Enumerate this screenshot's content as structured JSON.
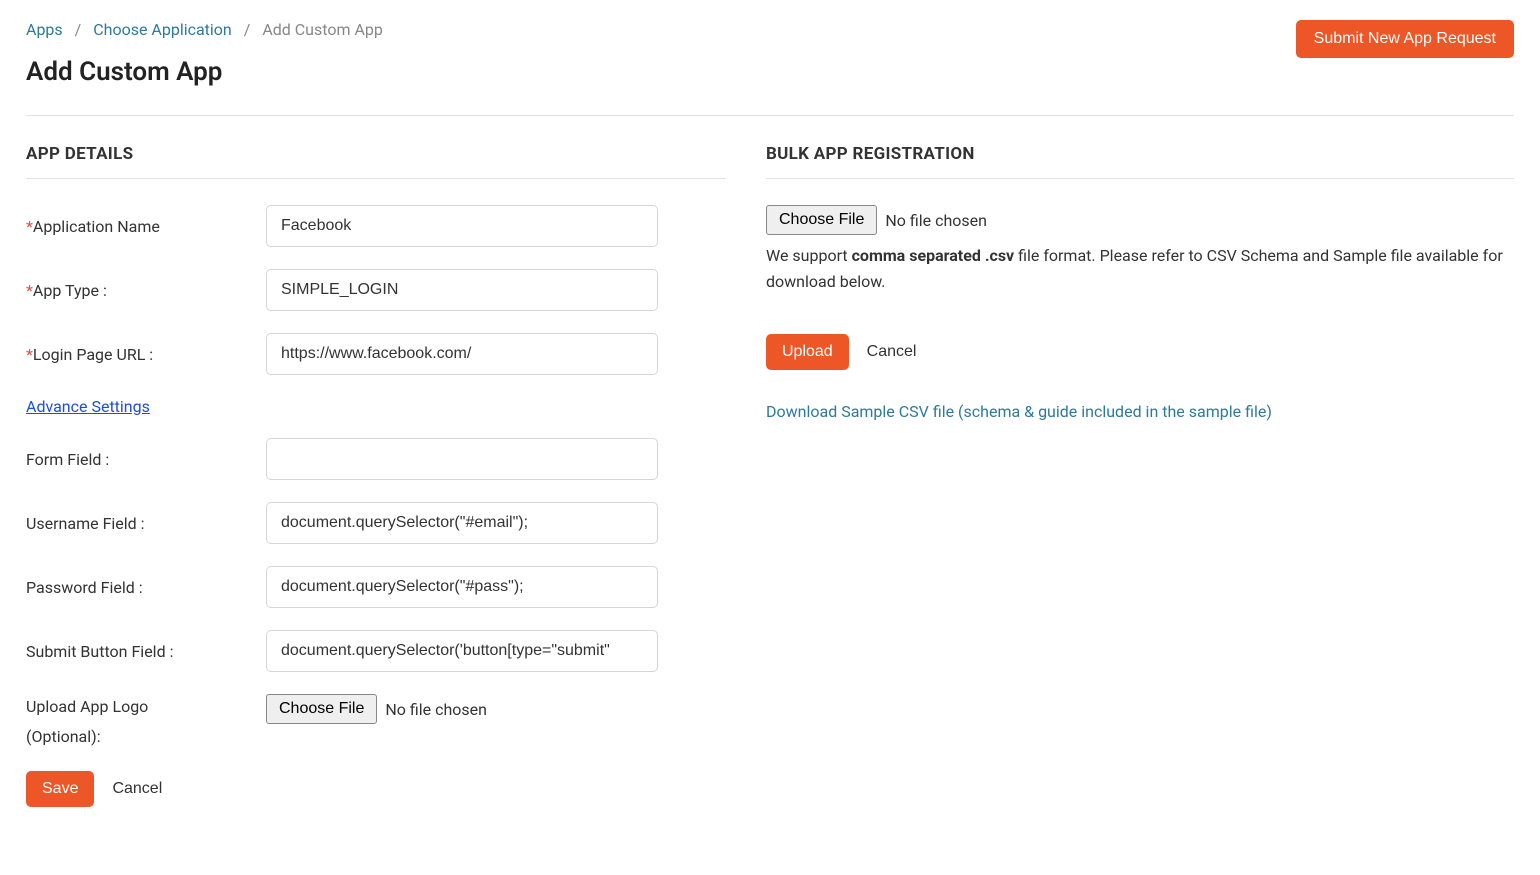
{
  "breadcrumb": {
    "apps": "Apps",
    "choose_app": "Choose Application",
    "current": "Add Custom App"
  },
  "header": {
    "title": "Add Custom App",
    "submit_request": "Submit New App Request"
  },
  "app_details": {
    "section_title": "APP DETAILS",
    "labels": {
      "app_name": "Application Name",
      "app_type": "App Type :",
      "login_url": "Login Page URL :",
      "advance_settings": "Advance Settings",
      "form_field": "Form Field :",
      "username_field": "Username Field :",
      "password_field": "Password Field :",
      "submit_button_field": "Submit Button Field :",
      "upload_logo": "Upload App Logo",
      "optional": "(Optional):"
    },
    "values": {
      "app_name": "Facebook",
      "app_type": "SIMPLE_LOGIN",
      "login_url": "https://www.facebook.com/",
      "form_field": "",
      "username_field": "document.querySelector(\"#email\");",
      "password_field": "document.querySelector(\"#pass\");",
      "submit_button_field": "document.querySelector('button[type=\"submit\""
    },
    "file": {
      "choose_file": "Choose File",
      "no_file": "No file chosen"
    },
    "actions": {
      "save": "Save",
      "cancel": "Cancel"
    }
  },
  "bulk": {
    "section_title": "BULK APP REGISTRATION",
    "file": {
      "choose_file": "Choose File",
      "no_file": "No file chosen"
    },
    "support_prefix": "We support ",
    "support_bold": "comma separated .csv",
    "support_suffix": " file format. Please refer to CSV Schema and Sample file available for download below.",
    "actions": {
      "upload": "Upload",
      "cancel": "Cancel"
    },
    "download_link": "Download Sample CSV file (schema & guide included in the sample file)"
  }
}
